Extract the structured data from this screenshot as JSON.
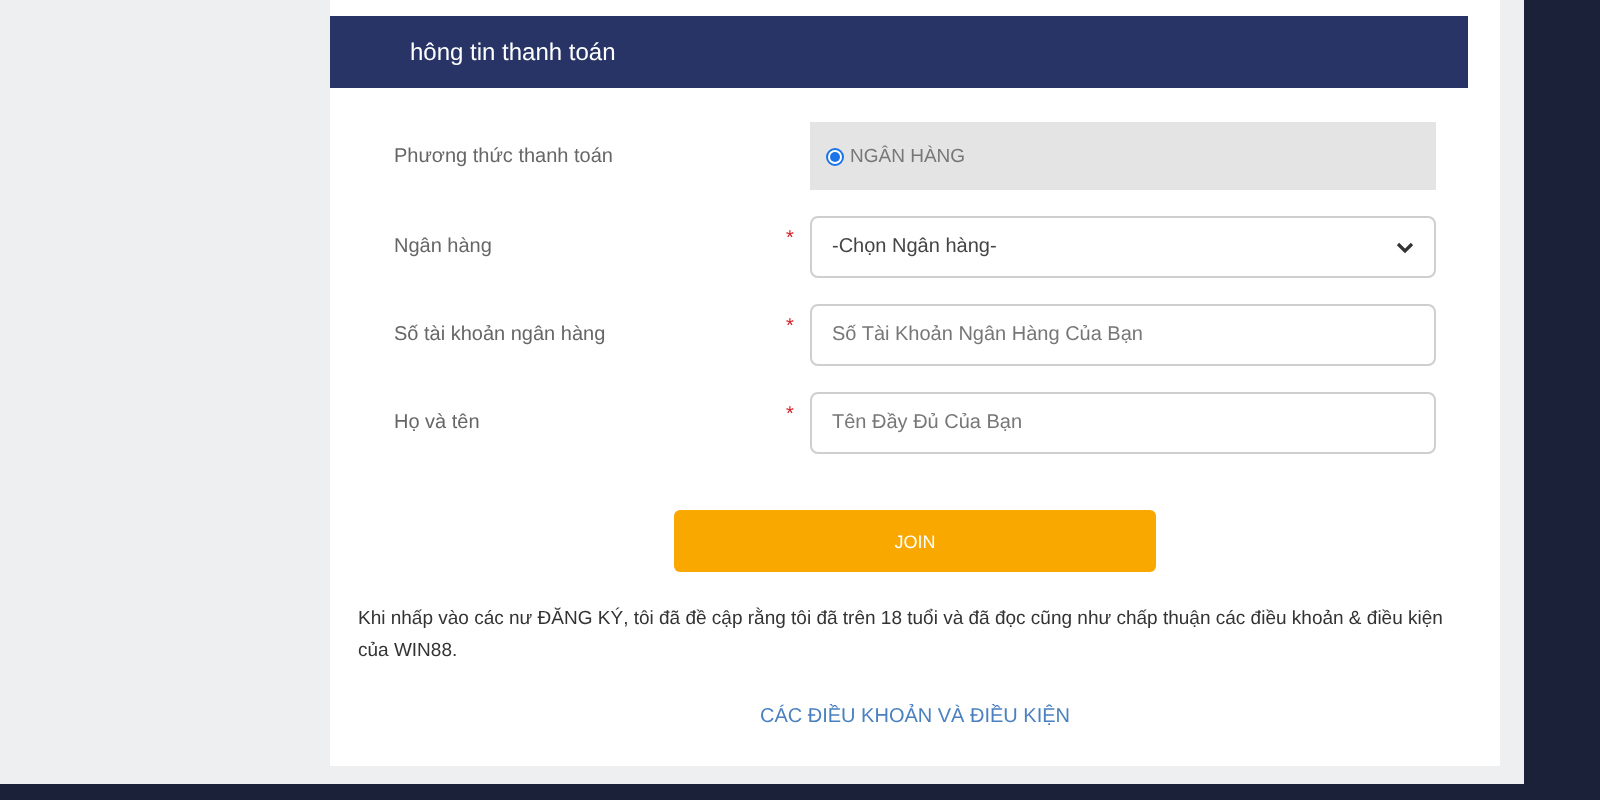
{
  "header": {
    "title": "hông tin thanh toán"
  },
  "fields": [
    {
      "kind": "radio",
      "label": "Phương thức thanh toán",
      "option": "NGÂN HÀNG",
      "checked": true
    },
    {
      "kind": "select",
      "label": "Ngân hàng",
      "mark": "*",
      "value": "-Chọn Ngân hàng-"
    },
    {
      "kind": "input",
      "label": "Số tài khoản ngân hàng",
      "mark": "*",
      "placeholder": "Số Tài Khoản Ngân Hàng Của Bạn"
    },
    {
      "kind": "input",
      "label": "Họ và tên",
      "mark": "*",
      "placeholder": "Tên Đầy Đủ Của Bạn"
    }
  ],
  "join_button": "JOIN",
  "notice": "Khi nhấp vào các nư ĐĂNG KÝ, tôi đã đề cập rằng tôi đã trên  18 tuổi và đã đọc cũng như chấp thuận các điều khoản & điều kiện của WIN88.",
  "terms_link": "CÁC ĐIỀU KHOẢN VÀ ĐIỀU KIỆN"
}
